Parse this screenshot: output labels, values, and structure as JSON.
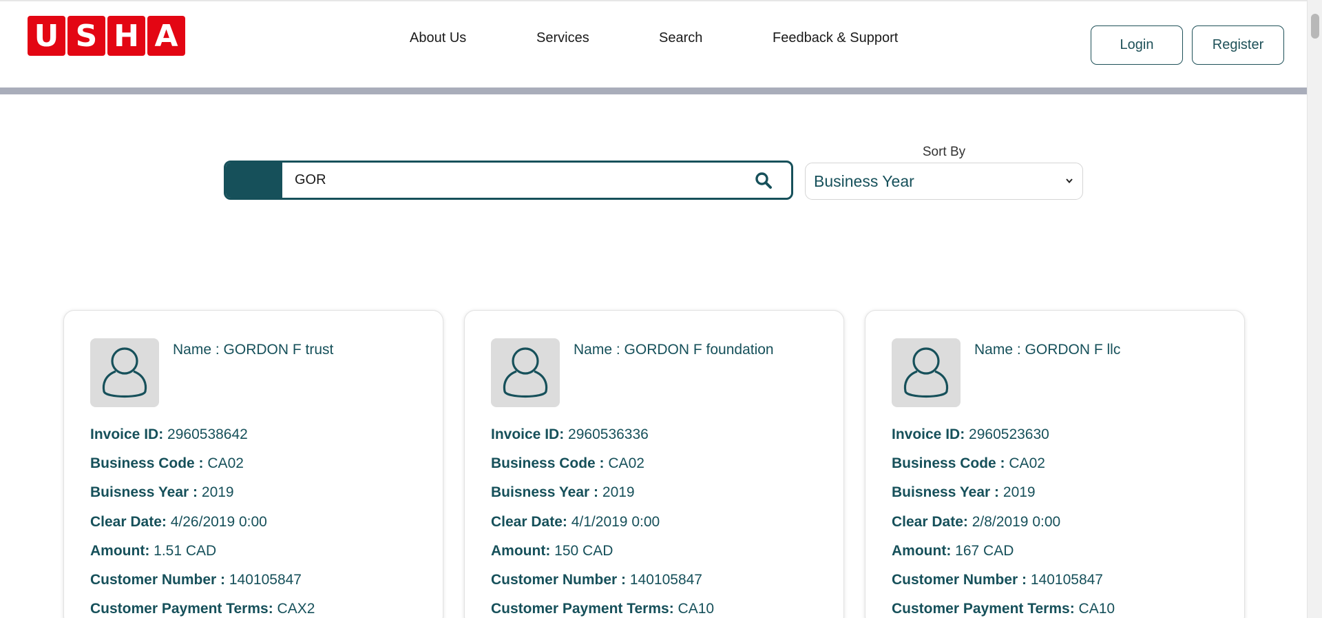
{
  "header": {
    "logo_letters": [
      "U",
      "S",
      "H",
      "A"
    ],
    "nav": [
      "About Us",
      "Services",
      "Search",
      "Feedback & Support"
    ],
    "login_label": "Login",
    "register_label": "Register"
  },
  "search": {
    "value": "GOR"
  },
  "sort": {
    "label": "Sort By",
    "selected": "Business Year"
  },
  "field_labels": {
    "invoice_id": "Invoice ID:",
    "business_code": "Business Code :",
    "business_year": "Buisness Year :",
    "clear_date": "Clear Date:",
    "amount": "Amount:",
    "customer_number": "Customer Number :",
    "payment_terms": "Customer Payment Terms:"
  },
  "cards": [
    {
      "name": "Name : GORDON F trust",
      "invoice_id": "2960538642",
      "business_code": "CA02",
      "business_year": "2019",
      "clear_date": "4/26/2019 0:00",
      "amount": "1.51 CAD",
      "customer_number": "140105847",
      "payment_terms": "CAX2"
    },
    {
      "name": "Name : GORDON F foundation",
      "invoice_id": "2960536336",
      "business_code": "CA02",
      "business_year": "2019",
      "clear_date": "4/1/2019 0:00",
      "amount": "150 CAD",
      "customer_number": "140105847",
      "payment_terms": "CA10"
    },
    {
      "name": "Name : GORDON F llc",
      "invoice_id": "2960523630",
      "business_code": "CA02",
      "business_year": "2019",
      "clear_date": "2/8/2019 0:00",
      "amount": "167 CAD",
      "customer_number": "140105847",
      "payment_terms": "CA10"
    }
  ],
  "colors": {
    "brand_red": "#e30613",
    "accent_teal": "#16505a",
    "divider_gray": "#a9adba"
  }
}
